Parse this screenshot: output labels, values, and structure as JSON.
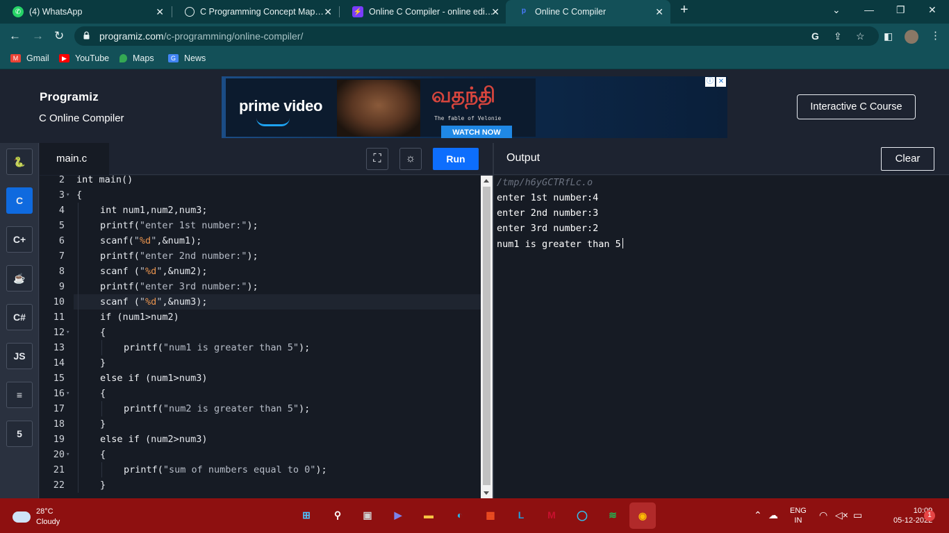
{
  "browser": {
    "tabs": [
      {
        "title": "(4) WhatsApp",
        "favicon": "whatsapp-icon",
        "color": "#25d366"
      },
      {
        "title": "C Programming Concept Map.pd",
        "favicon": "globe-icon",
        "color": "#e8f2f2"
      },
      {
        "title": "Online C Compiler - online editor",
        "favicon": "lightning-icon",
        "color": "#7a3cff"
      },
      {
        "title": "Online C Compiler",
        "favicon": "programiz-icon",
        "color": "#3b6cff"
      }
    ],
    "new_tab_symbol": "+",
    "url_host": "programiz.com",
    "url_path": "/c-programming/online-compiler/",
    "bookmarks": [
      {
        "label": "Gmail",
        "icon": "gmail-icon",
        "color": "#ea4335"
      },
      {
        "label": "YouTube",
        "icon": "youtube-icon",
        "color": "#ff0000"
      },
      {
        "label": "Maps",
        "icon": "maps-icon",
        "color": "#34a853"
      },
      {
        "label": "News",
        "icon": "news-icon",
        "color": "#4285f4"
      }
    ]
  },
  "site": {
    "logo": "Programiz",
    "subtitle": "C Online Compiler",
    "course_button": "Interactive C Course",
    "ad": {
      "brand": "prime video",
      "tamil_title": "வதந்தி",
      "tagline": "The fable of Velonie",
      "cta": "WATCH NOW"
    }
  },
  "languages": [
    {
      "name": "python-lang-icon",
      "glyph": "🐍",
      "active": false
    },
    {
      "name": "c-lang-icon",
      "glyph": "C",
      "active": true
    },
    {
      "name": "cpp-lang-icon",
      "glyph": "C+",
      "active": false
    },
    {
      "name": "java-lang-icon",
      "glyph": "☕",
      "active": false
    },
    {
      "name": "csharp-lang-icon",
      "glyph": "C#",
      "active": false
    },
    {
      "name": "javascript-lang-icon",
      "glyph": "JS",
      "active": false
    },
    {
      "name": "sql-lang-icon",
      "glyph": "≡",
      "active": false
    },
    {
      "name": "html-lang-icon",
      "glyph": "5",
      "active": false
    }
  ],
  "editor": {
    "filename": "main.c",
    "run_label": "Run",
    "fullscreen_icon": "⛶",
    "theme_icon": "☼",
    "current_line": 10,
    "lines": [
      {
        "n": "2",
        "fold": "",
        "indent": 0,
        "tokens": [
          [
            "kw",
            "int"
          ],
          [
            "",
            "main()"
          ]
        ]
      },
      {
        "n": "3",
        "fold": "▾",
        "indent": 0,
        "tokens": [
          [
            "",
            "{"
          ]
        ]
      },
      {
        "n": "4",
        "fold": "",
        "indent": 1,
        "tokens": [
          [
            "kw",
            "int"
          ],
          [
            "",
            "num1,num2,num3;"
          ]
        ]
      },
      {
        "n": "5",
        "fold": "",
        "indent": 1,
        "tokens": [
          [
            "fn",
            "printf("
          ],
          [
            "str",
            "\"enter 1st number:\""
          ],
          [
            "",
            ");"
          ]
        ]
      },
      {
        "n": "6",
        "fold": "",
        "indent": 1,
        "tokens": [
          [
            "fn",
            "scanf("
          ],
          [
            "str",
            "\""
          ],
          [
            "fmt",
            "%d"
          ],
          [
            "str",
            "\""
          ],
          [
            "",
            ",&num1);"
          ]
        ]
      },
      {
        "n": "7",
        "fold": "",
        "indent": 1,
        "tokens": [
          [
            "fn",
            "printf("
          ],
          [
            "str",
            "\"enter 2nd number:\""
          ],
          [
            "",
            ");"
          ]
        ]
      },
      {
        "n": "8",
        "fold": "",
        "indent": 1,
        "tokens": [
          [
            "fn",
            "scanf ("
          ],
          [
            "str",
            "\""
          ],
          [
            "fmt",
            "%d"
          ],
          [
            "str",
            "\""
          ],
          [
            "",
            ",&num2);"
          ]
        ]
      },
      {
        "n": "9",
        "fold": "",
        "indent": 1,
        "tokens": [
          [
            "fn",
            "printf("
          ],
          [
            "str",
            "\"enter 3rd number:\""
          ],
          [
            "",
            ");"
          ]
        ]
      },
      {
        "n": "10",
        "fold": "",
        "indent": 1,
        "tokens": [
          [
            "fn",
            "scanf ("
          ],
          [
            "str",
            "\""
          ],
          [
            "fmt",
            "%d"
          ],
          [
            "str",
            "\""
          ],
          [
            "",
            ",&num3);"
          ]
        ]
      },
      {
        "n": "11",
        "fold": "",
        "indent": 1,
        "tokens": [
          [
            "kw",
            "if"
          ],
          [
            "",
            "(num1>num2)"
          ]
        ]
      },
      {
        "n": "12",
        "fold": "▾",
        "indent": 1,
        "tokens": [
          [
            "",
            "{"
          ]
        ]
      },
      {
        "n": "13",
        "fold": "",
        "indent": 2,
        "tokens": [
          [
            "fn",
            "printf("
          ],
          [
            "str",
            "\"num1 is greater than 5\""
          ],
          [
            "",
            ");"
          ]
        ]
      },
      {
        "n": "14",
        "fold": "",
        "indent": 1,
        "tokens": [
          [
            "",
            "}"
          ]
        ]
      },
      {
        "n": "15",
        "fold": "",
        "indent": 1,
        "tokens": [
          [
            "kw",
            "else if"
          ],
          [
            "",
            "(num1>num3)"
          ]
        ]
      },
      {
        "n": "16",
        "fold": "▾",
        "indent": 1,
        "tokens": [
          [
            "",
            "{"
          ]
        ]
      },
      {
        "n": "17",
        "fold": "",
        "indent": 2,
        "tokens": [
          [
            "fn",
            "printf("
          ],
          [
            "str",
            "\"num2 is greater than 5\""
          ],
          [
            "",
            ");"
          ]
        ]
      },
      {
        "n": "18",
        "fold": "",
        "indent": 1,
        "tokens": [
          [
            "",
            "}"
          ]
        ]
      },
      {
        "n": "19",
        "fold": "",
        "indent": 1,
        "tokens": [
          [
            "kw",
            "else if"
          ],
          [
            "",
            "(num2>num3)"
          ]
        ]
      },
      {
        "n": "20",
        "fold": "▾",
        "indent": 1,
        "tokens": [
          [
            "",
            "{"
          ]
        ]
      },
      {
        "n": "21",
        "fold": "",
        "indent": 2,
        "tokens": [
          [
            "fn",
            "printf("
          ],
          [
            "str",
            "\"sum of numbers equal to 0\""
          ],
          [
            "",
            ");"
          ]
        ]
      },
      {
        "n": "22",
        "fold": "",
        "indent": 1,
        "tokens": [
          [
            "",
            "}"
          ]
        ]
      }
    ]
  },
  "output": {
    "title": "Output",
    "clear_label": "Clear",
    "path": "/tmp/h6yGCTRfLc.o",
    "lines": [
      "enter 1st number:4",
      "enter 2nd number:3",
      "enter 3rd number:2",
      "num1 is greater than 5"
    ]
  },
  "taskbar": {
    "temperature": "28°C",
    "condition": "Cloudy",
    "language": "ENG",
    "region": "IN",
    "time": "10:09",
    "date": "05-12-2022",
    "notifications": "1",
    "apps": [
      {
        "name": "start-icon",
        "glyph": "⊞",
        "color": "#4cc2ff"
      },
      {
        "name": "search-icon",
        "glyph": "⚲",
        "color": "#ffffff"
      },
      {
        "name": "task-view-icon",
        "glyph": "▣",
        "color": "#d0d0d0"
      },
      {
        "name": "teams-icon",
        "glyph": "▶",
        "color": "#7b83eb"
      },
      {
        "name": "file-explorer-icon",
        "glyph": "▬",
        "color": "#f6c443"
      },
      {
        "name": "edge-icon",
        "glyph": "◐",
        "color": "#2ab7ea"
      },
      {
        "name": "store-icon",
        "glyph": "▦",
        "color": "#f25022"
      },
      {
        "name": "l-app-icon",
        "glyph": "L",
        "color": "#1fa2e0"
      },
      {
        "name": "mcafee-icon",
        "glyph": "M",
        "color": "#c8102e"
      },
      {
        "name": "alexa-icon",
        "glyph": "◯",
        "color": "#31c4f3"
      },
      {
        "name": "spotify-icon",
        "glyph": "≋",
        "color": "#1db954"
      },
      {
        "name": "chrome-icon",
        "glyph": "◉",
        "color": "#fbbc05"
      }
    ]
  }
}
